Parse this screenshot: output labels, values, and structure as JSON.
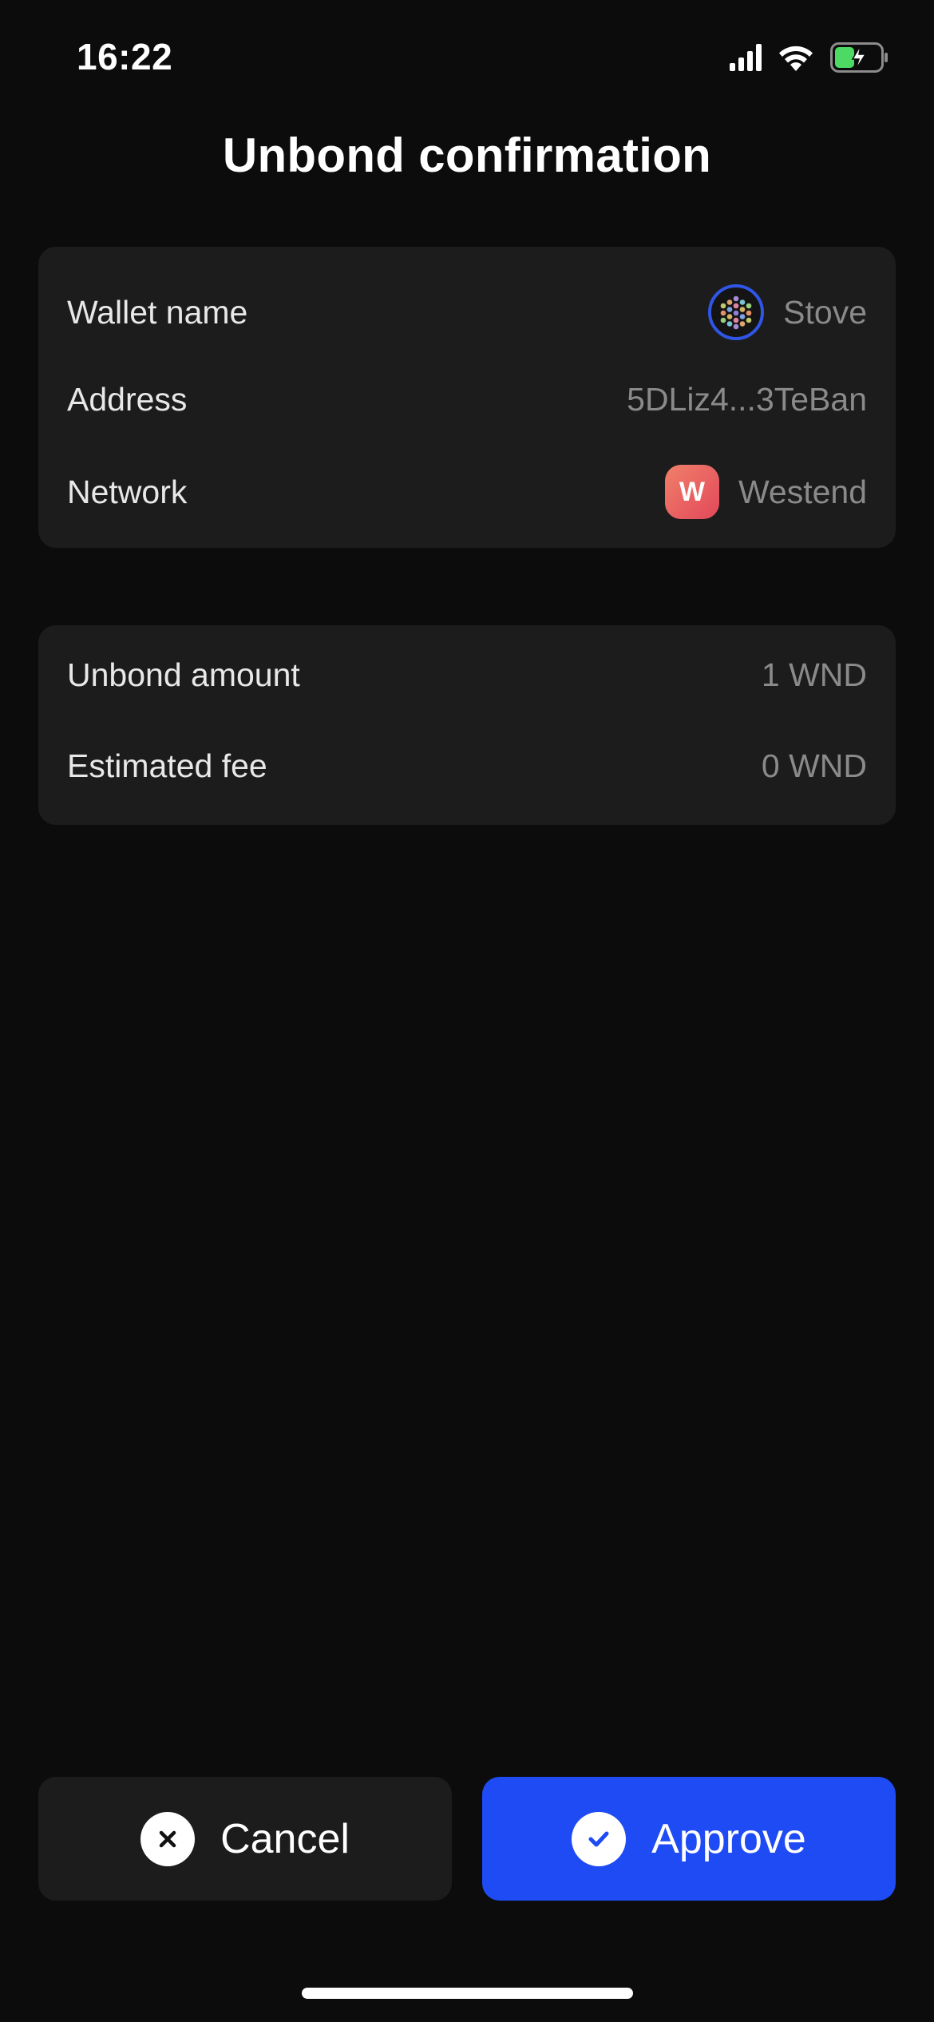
{
  "status_bar": {
    "time": "16:22",
    "icons": [
      "signal-icon",
      "wifi-icon",
      "battery-charging-icon"
    ],
    "battery_color": "#4cd964"
  },
  "title": "Unbond confirmation",
  "details": {
    "wallet": {
      "label": "Wallet name",
      "value": "Stove",
      "icon": "identicon-icon"
    },
    "address": {
      "label": "Address",
      "value": "5DLiz4...3TeBan"
    },
    "network": {
      "label": "Network",
      "value": "Westend",
      "icon": "westend-network-icon",
      "icon_letter": "W"
    }
  },
  "amounts": {
    "unbond": {
      "label": "Unbond amount",
      "value": "1 WND"
    },
    "fee": {
      "label": "Estimated fee",
      "value": "0 WND"
    }
  },
  "actions": {
    "cancel_label": "Cancel",
    "approve_label": "Approve"
  },
  "colors": {
    "background": "#0c0c0c",
    "card": "#1c1c1c",
    "accent": "#1f4bf5",
    "muted_text": "#8a8a8a"
  }
}
